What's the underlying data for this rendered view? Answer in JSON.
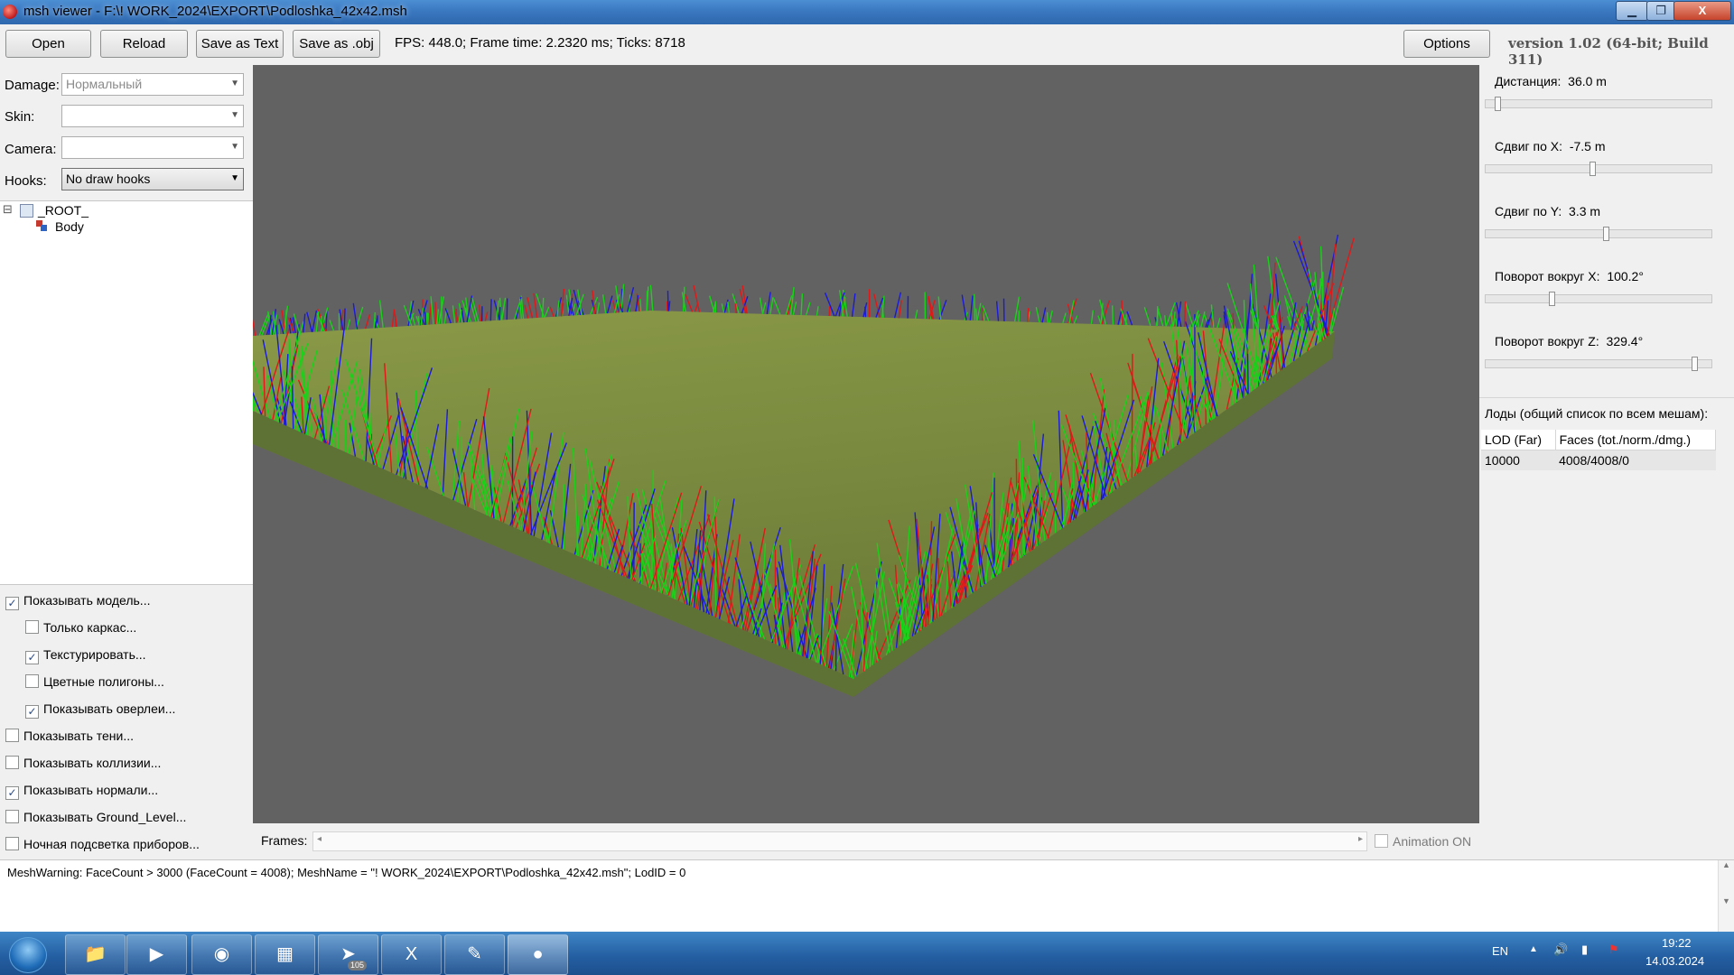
{
  "window": {
    "title": "msh viewer - F:\\!   WORK_2024\\EXPORT\\Podloshka_42x42.msh",
    "controls": {
      "minimize": "▁",
      "maximize": "❐",
      "close": "X"
    }
  },
  "toolbar": {
    "open": "Open",
    "reload": "Reload",
    "save_text": "Save as Text",
    "save_obj": "Save as .obj",
    "fps": "FPS: 448.0; Frame time: 2.2320 ms; Ticks: 8718",
    "options": "Options",
    "version": "version 1.02 (64-bit; Build 311)"
  },
  "left": {
    "damage": {
      "label": "Damage:",
      "value": "Нормальный"
    },
    "skin": {
      "label": "Skin:",
      "value": ""
    },
    "camera": {
      "label": "Camera:",
      "value": ""
    },
    "hooks": {
      "label": "Hooks:",
      "value": "No draw hooks"
    },
    "tree": {
      "root": "_ROOT_",
      "child": "Body",
      "expander": "⊟"
    },
    "checks": [
      {
        "label": "Показывать модель...",
        "checked": true,
        "indent": 0
      },
      {
        "label": "Только каркас...",
        "checked": false,
        "indent": 1
      },
      {
        "label": "Текстурировать...",
        "checked": true,
        "indent": 1
      },
      {
        "label": "Цветные полигоны...",
        "checked": false,
        "indent": 1
      },
      {
        "label": "Показывать оверлеи...",
        "checked": true,
        "indent": 1
      },
      {
        "label": "Показывать тени...",
        "checked": false,
        "indent": 0
      },
      {
        "label": "Показывать коллизии...",
        "checked": false,
        "indent": 0
      },
      {
        "label": "Показывать нормали...",
        "checked": true,
        "indent": 0
      },
      {
        "label": "Показывать Ground_Level...",
        "checked": false,
        "indent": 0
      },
      {
        "label": "Ночная подсветка приборов...",
        "checked": false,
        "indent": 0
      }
    ]
  },
  "frames": {
    "label": "Frames:",
    "animation": "Animation ON",
    "animation_on": false
  },
  "right": {
    "sliders": [
      {
        "label": "Дистанция:",
        "value": "36.0 m",
        "pos": 0.04
      },
      {
        "label": "Сдвиг по X:",
        "value": "-7.5 m",
        "pos": 0.46
      },
      {
        "label": "Сдвиг по Y:",
        "value": "3.3 m",
        "pos": 0.52
      },
      {
        "label": "Поворот вокруг X:",
        "value": "100.2°",
        "pos": 0.28
      },
      {
        "label": "Поворот вокруг Z:",
        "value": "329.4°",
        "pos": 0.91
      }
    ],
    "lods_title": "Лоды (общий список по всем мешам):",
    "lods_headers": [
      "LOD (Far)",
      "Faces (tot./norm./dmg.)"
    ],
    "lods_rows": [
      [
        "10000",
        "4008/4008/0"
      ]
    ]
  },
  "log": {
    "text": "MeshWarning: FaceCount > 3000 (FaceCount = 4008); MeshName = \"!   WORK_2024\\EXPORT\\Podloshka_42x42.msh\"; LodID = 0"
  },
  "taskbar": {
    "lang": "EN",
    "time": "19:22",
    "date": "14.03.2024",
    "telegram_badge": "105",
    "items": [
      "explorer-icon",
      "media-player-icon",
      "chrome-icon",
      "calculator-icon",
      "telegram-icon",
      "excel-icon",
      "editor-icon",
      "msh-viewer-icon"
    ]
  },
  "colors": {
    "viewport_bg": "#626262",
    "model_green": "#7a8a3e",
    "normal_red": "#e01818",
    "normal_green": "#19d219",
    "normal_blue": "#1a1ad8"
  }
}
